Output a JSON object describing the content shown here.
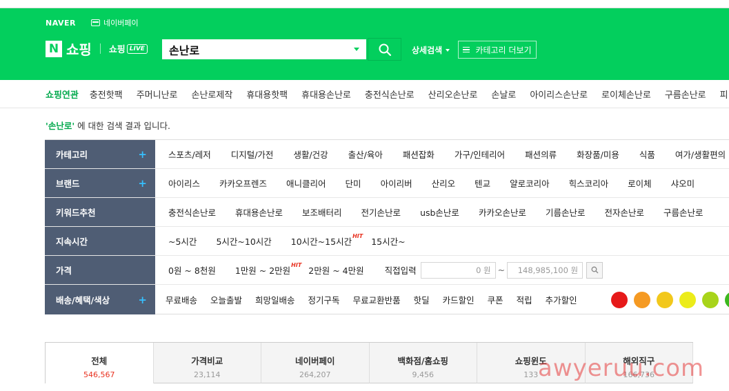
{
  "gnb": {
    "naver": "NAVER",
    "npay": "네이버페이"
  },
  "brand": {
    "n": "N",
    "shopping": "쇼핑",
    "live": "쇼핑",
    "live_badge": "LIVE"
  },
  "search": {
    "value": "손난로",
    "button_icon": "search-icon"
  },
  "header_links": {
    "advanced_search": "상세검색",
    "category_more": "카테고리 더보기"
  },
  "related": {
    "title": "쇼핑연관",
    "items": [
      "충전핫팩",
      "주머니난로",
      "손난로제작",
      "휴대용핫팩",
      "휴대용손난로",
      "충전식손난로",
      "산리오손난로",
      "손날로",
      "아이리스손난로",
      "로이체손난로",
      "구름손난로",
      "피..."
    ]
  },
  "result_message": {
    "keyword": "'손난로'",
    "text": " 에 대한 검색 결과 입니다."
  },
  "filters": {
    "category": {
      "title": "카테고리",
      "plus": "+",
      "items": [
        "스포츠/레저",
        "디지털/가전",
        "생활/건강",
        "출산/육아",
        "패션잡화",
        "가구/인테리어",
        "패션의류",
        "화장품/미용",
        "식품",
        "여가/생활편의"
      ]
    },
    "brand": {
      "title": "브랜드",
      "plus": "+",
      "items": [
        "아이리스",
        "카카오프렌즈",
        "애니클리어",
        "단미",
        "아이리버",
        "산리오",
        "텐교",
        "얄로코리아",
        "힉스코리아",
        "로이체",
        "샤오미"
      ]
    },
    "keyword": {
      "title": "키워드추천",
      "items": [
        "충전식손난로",
        "휴대용손난로",
        "보조배터리",
        "전기손난로",
        "usb손난로",
        "카카오손난로",
        "기름손난로",
        "전자손난로",
        "구름손난로"
      ]
    },
    "duration": {
      "title": "지속시간",
      "items": [
        "~5시간",
        "5시간~10시간",
        "10시간~15시간",
        "15시간~"
      ],
      "hit": "HIT"
    },
    "price": {
      "title": "가격",
      "items": [
        "0원 ~ 8천원",
        "1만원 ~ 2만원",
        "2만원 ~ 4만원"
      ],
      "hit": "HIT",
      "direct": "직접입력",
      "min": "0 원",
      "tilde": "~",
      "max": "148,985,100 원"
    },
    "delivery": {
      "title": "배송/혜택/색상",
      "plus": "+",
      "items": [
        "무료배송",
        "오늘출발",
        "희망일배송",
        "정기구독",
        "무료교환반품",
        "핫딜",
        "카드할인",
        "쿠폰",
        "적립",
        "추가할인"
      ],
      "colors": [
        "#e61a1a",
        "#f59a23",
        "#f2c81c",
        "#ecec1a",
        "#a8d41a",
        "#3cb81e"
      ]
    }
  },
  "tabs": [
    {
      "label": "전체",
      "count": "546,567"
    },
    {
      "label": "가격비교",
      "count": "23,114"
    },
    {
      "label": "네이버페이",
      "count": "264,207"
    },
    {
      "label": "백화점/홈쇼핑",
      "count": "9,456"
    },
    {
      "label": "쇼핑윈도",
      "count": "133"
    },
    {
      "label": "해외직구",
      "count": "166,736"
    }
  ],
  "watermark": "awyeruu.com"
}
